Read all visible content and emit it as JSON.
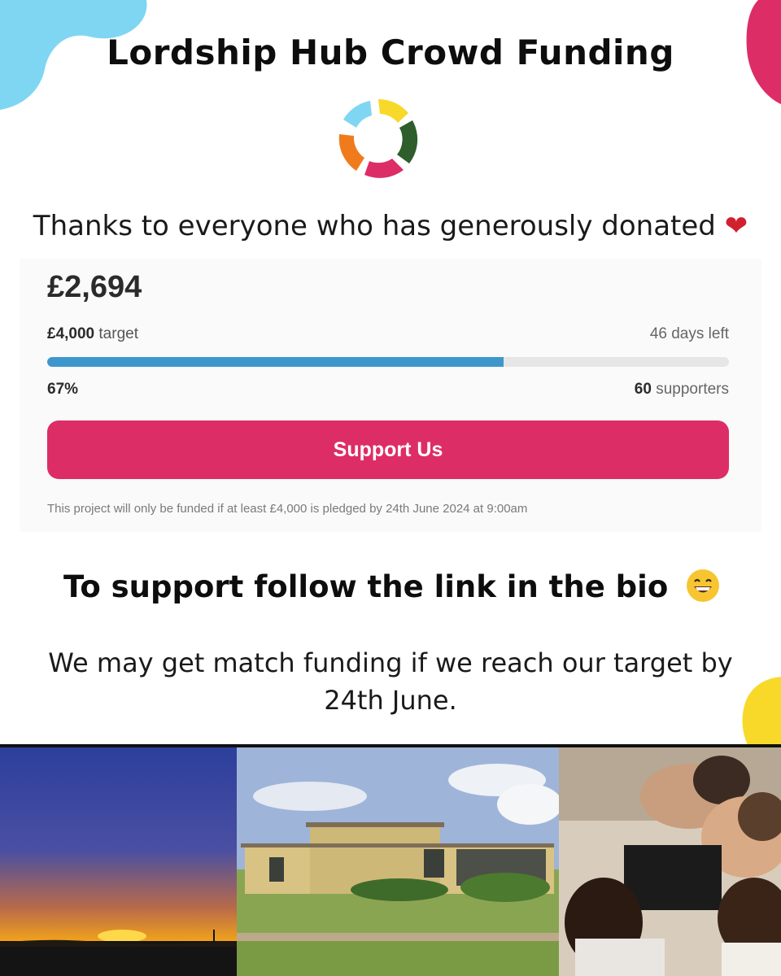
{
  "title": "Lordship Hub Crowd Funding",
  "thanks": {
    "text": "Thanks to everyone who has generously donated",
    "emoji": "❤"
  },
  "campaign": {
    "amount_raised": "£2,694",
    "target_amount": "£4,000",
    "target_label": "target",
    "days_left": "46 days left",
    "progress_fraction": 0.67,
    "progress_percent_label": "67%",
    "supporters_count": "60",
    "supporters_label": "supporters",
    "button_label": "Support Us",
    "note": "This project will only be funded if at least £4,000 is pledged by 24th June 2024 at 9:00am"
  },
  "follow_text": "To support follow the link in the bio",
  "match_text": "We may get match funding if we reach our target by 24th June.",
  "colors": {
    "accent_pink": "#dd2d67",
    "progress_blue": "#3d97cc",
    "blob_blue": "#7fd6f2",
    "blob_yellow": "#f8d92a",
    "logo_green": "#2e5e2b",
    "logo_orange": "#f07b1d"
  },
  "photos": [
    {
      "icon": "sunset-photo"
    },
    {
      "icon": "community-hub-building-photo"
    },
    {
      "icon": "laughing-group-photo"
    }
  ]
}
